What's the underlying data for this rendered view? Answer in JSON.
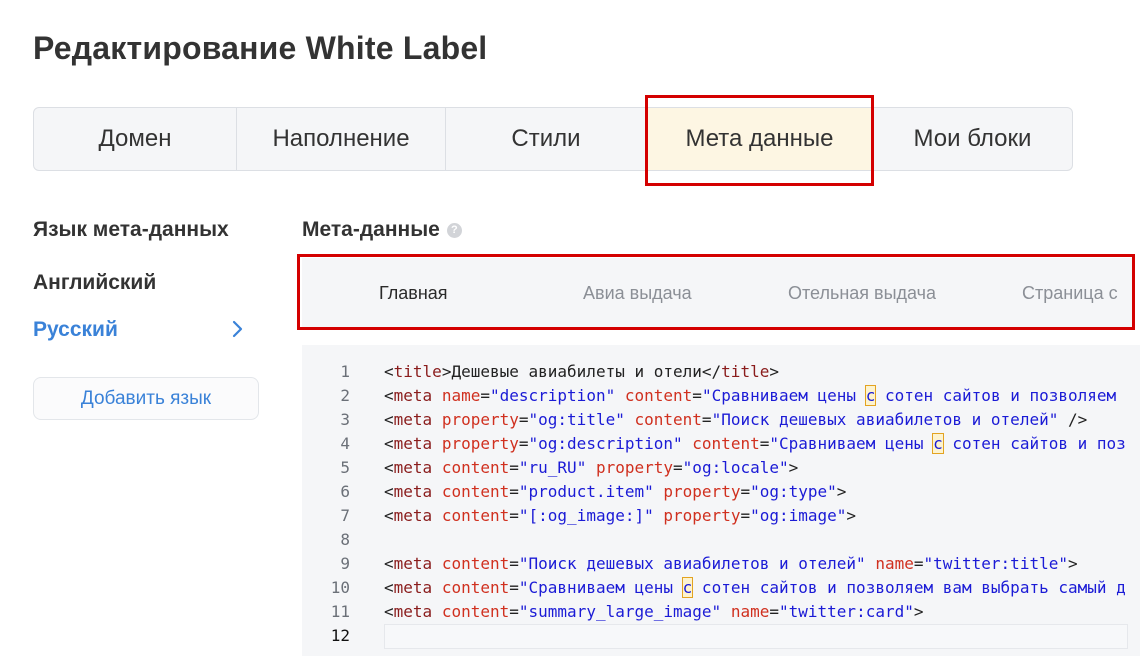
{
  "page": {
    "title": "Редактирование White Label"
  },
  "tabs": [
    {
      "label": "Домен"
    },
    {
      "label": "Наполнение"
    },
    {
      "label": "Стили"
    },
    {
      "label": "Мета данные"
    },
    {
      "label": "Мои блоки"
    }
  ],
  "sidebar": {
    "title": "Язык мета-данных",
    "languages": [
      {
        "label": "Английский"
      },
      {
        "label": "Русский"
      }
    ],
    "add_language": "Добавить язык"
  },
  "meta": {
    "title": "Мета-данные",
    "help_glyph": "?",
    "subtabs": [
      {
        "label": "Главная"
      },
      {
        "label": "Авиа выдача"
      },
      {
        "label": "Отельная выдача"
      },
      {
        "label": "Страница с"
      }
    ]
  },
  "editor": {
    "line_numbers": [
      "1",
      "2",
      "3",
      "4",
      "5",
      "6",
      "7",
      "8",
      "9",
      "10",
      "11",
      "12"
    ],
    "lines": [
      "<title>Дешевые авиабилеты и отели</title>",
      "<meta name=\"description\" content=\"Сравниваем цены с сотен сайтов и позволяем",
      "<meta property=\"og:title\" content=\"Поиск дешевых авиабилетов и отелей\" />",
      "<meta property=\"og:description\" content=\"Сравниваем цены с сотен сайтов и поз",
      "<meta content=\"ru_RU\" property=\"og:locale\">",
      "<meta content=\"product.item\" property=\"og:type\">",
      "<meta content=\"[:og_image:]\" property=\"og:image\">",
      "",
      "<meta content=\"Поиск дешевых авиабилетов и отелей\" name=\"twitter:title\">",
      "<meta content=\"Сравниваем цены с сотен сайтов и позволяем вам выбрать самый д",
      "<meta content=\"summary_large_image\" name=\"twitter:card\">",
      ""
    ]
  },
  "colors": {
    "accent": "#3a82d8",
    "active_tab_bg": "#fdf6e3",
    "highlight_border": "#d40000",
    "code_tag": "#8a1c1c",
    "code_attr": "#d0301f",
    "code_string": "#1b1bd6"
  }
}
